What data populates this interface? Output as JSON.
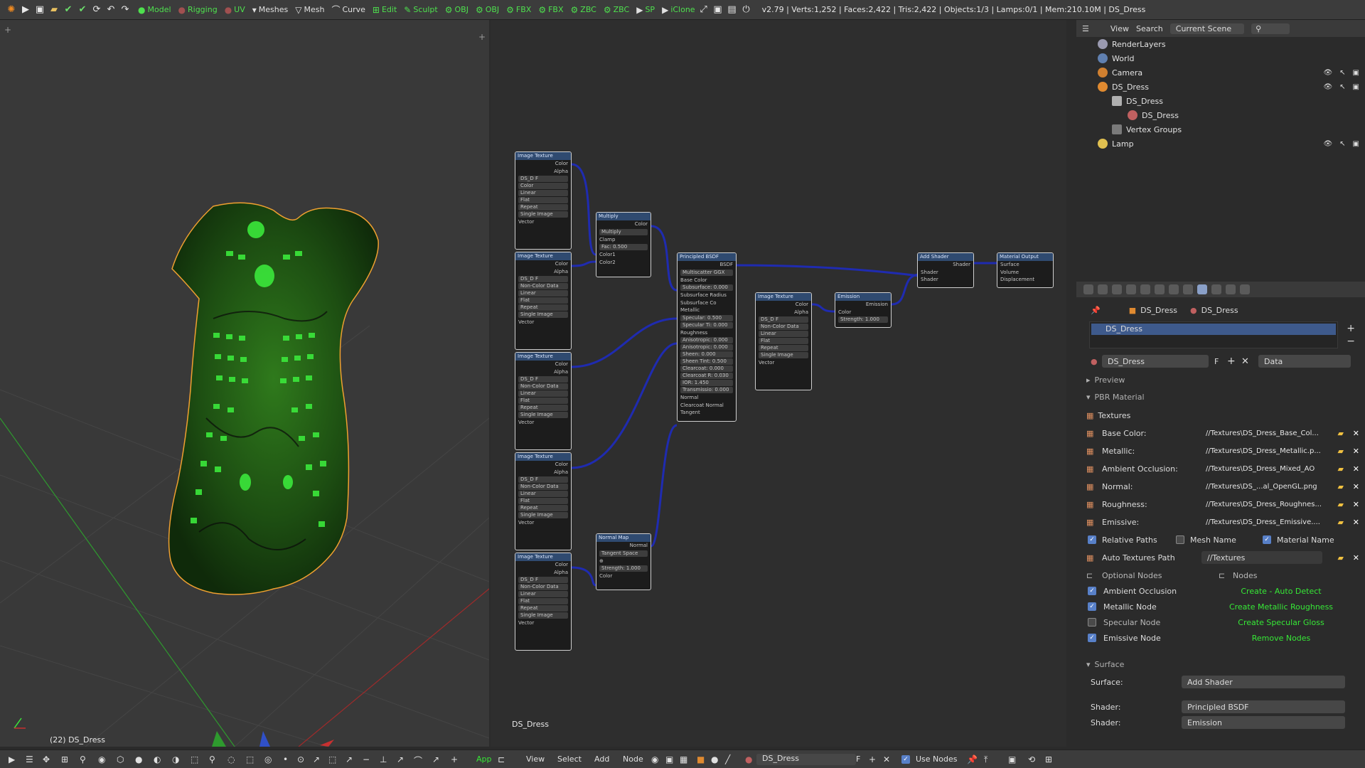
{
  "topbar": {
    "menus": [
      "Model",
      "Rigging",
      "UV",
      "Meshes",
      "Mesh",
      "Curve",
      "Edit",
      "Sculpt",
      "OBJ",
      "OBJ",
      "FBX",
      "FBX",
      "ZBC",
      "ZBC",
      "SP",
      "iClone"
    ],
    "stats": "v2.79 | Verts:1,252 | Faces:2,422 | Tris:2,422 | Objects:1/3 | Lamps:0/1 | Mem:210.10M | DS_Dress"
  },
  "viewport": {
    "label": "(22) DS_Dress"
  },
  "nodes": {
    "image_texture_title": "Image Texture",
    "multiply_title": "Multiply",
    "principled_title": "Principled BSDF",
    "emission_title": "Emission",
    "add_shader_title": "Add Shader",
    "output_title": "Material Output",
    "normal_map_title": "Normal Map",
    "tex_rows": [
      "Color",
      "Alpha",
      "DS_D F",
      "Non-Color Data",
      "Linear",
      "Flat",
      "Repeat",
      "Single Image",
      "Vector"
    ],
    "tex1_rows": [
      "Color",
      "Alpha",
      "DS_D F",
      "Color",
      "Linear",
      "Flat",
      "Repeat",
      "Single Image",
      "Vector"
    ],
    "multiply_rows": [
      "Color",
      "Multiply",
      "Clamp",
      "Fac: 0.500",
      "Color1",
      "Color2"
    ],
    "principled_rows": [
      "BSDF",
      "Multiscatter GGX",
      "Base Color",
      "Subsurface: 0.000",
      "Subsurface Radius",
      "Subsurface Co",
      "Metallic",
      "Specular: 0.500",
      "Specular Ti: 0.000",
      "Roughness",
      "Anisotropic: 0.000",
      "Anisotropic: 0.000",
      "Sheen: 0.000",
      "Sheen Tint: 0.500",
      "Clearcoat: 0.000",
      "Clearcoat R: 0.030",
      "IOR: 1.450",
      "Transmissio: 0.000",
      "Normal",
      "Clearcoat Normal",
      "Tangent"
    ],
    "emission_rows": [
      "Emission",
      "Color",
      "Strength: 1.000"
    ],
    "add_rows": [
      "Shader",
      "Shader",
      "Shader"
    ],
    "output_rows": [
      "Surface",
      "Volume",
      "Displacement"
    ],
    "normal_rows": [
      "Normal",
      "Tangent Space",
      "Strength: 1.000",
      "Color"
    ],
    "editor_label": "DS_Dress"
  },
  "outliner": {
    "header": [
      "View",
      "Search",
      "Current Scene"
    ],
    "items": [
      "RenderLayers",
      "World",
      "Camera",
      "DS_Dress",
      "DS_Dress",
      "DS_Dress",
      "Vertex Groups",
      "Lamp"
    ]
  },
  "properties": {
    "breadcrumb": [
      "DS_Dress",
      "DS_Dress"
    ],
    "material_slot": "DS_Dress",
    "material_name": "DS_Dress",
    "material_f": "F",
    "data_select": "Data",
    "preview": "Preview",
    "pbr": "PBR Material",
    "textures": "Textures",
    "tex_labels": [
      "Base Color:",
      "Metallic:",
      "Ambient Occlusion:",
      "Normal:",
      "Roughness:",
      "Emissive:"
    ],
    "tex_values": [
      "//Textures\\DS_Dress_Base_Col...",
      "//Textures\\DS_Dress_Metallic.p...",
      "//Textures\\DS_Dress_Mixed_AO",
      "//Textures\\DS_...al_OpenGL.png",
      "//Textures\\DS_Dress_Roughnes...",
      "//Textures\\DS_Dress_Emissive...."
    ],
    "relative_paths": "Relative Paths",
    "mesh_name": "Mesh Name",
    "material_name_opt": "Material Name",
    "auto_textures_path": "Auto Textures Path",
    "auto_textures_value": "//Textures",
    "optional_nodes": "Optional Nodes",
    "nodes": "Nodes",
    "opt_labels": [
      "Ambient Occlusion",
      "Metallic Node",
      "Specular Node",
      "Emissive Node"
    ],
    "opt_buttons": [
      "Create - Auto Detect",
      "Create Metallic Roughness",
      "Create Specular Gloss",
      "Remove Nodes"
    ],
    "surface_panel": "Surface",
    "surface_label": "Surface:",
    "surface_value": "Add Shader",
    "shader_label": "Shader:",
    "shader_value": "Principled BSDF",
    "shader2_value": "Emission"
  },
  "bottombar": {
    "viewport_app": "App",
    "node_menus": [
      "View",
      "Select",
      "Add",
      "Node"
    ],
    "material": "DS_Dress",
    "material_f": "F",
    "use_nodes": "Use Nodes"
  },
  "colors": {
    "accent": "#5880c8",
    "green_button": "#36e836",
    "noodle": "#1f2bb0",
    "glow": "#3be83b",
    "selection": "#f0a030"
  }
}
